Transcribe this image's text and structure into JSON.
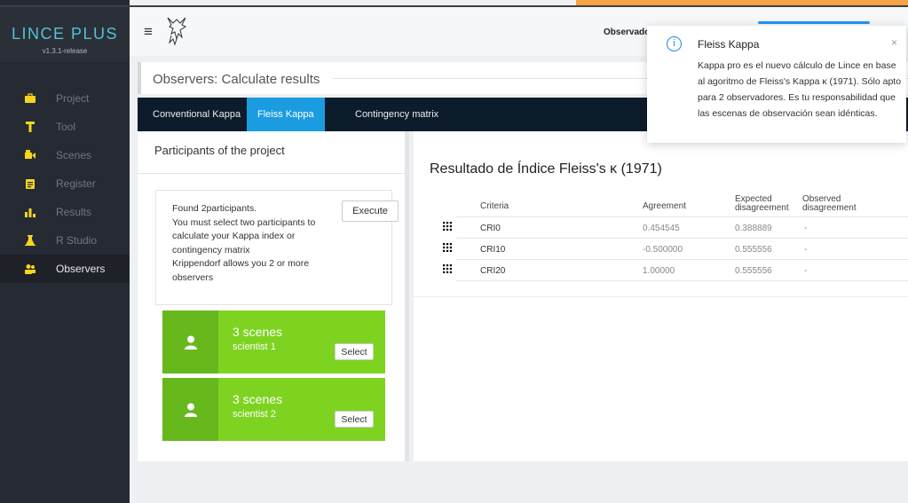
{
  "app": {
    "brand": "LINCE PLUS",
    "version": "v1.3.1-release"
  },
  "sidebar": {
    "items": [
      {
        "label": "Project",
        "icon": "briefcase-icon"
      },
      {
        "label": "Tool",
        "icon": "tool-icon"
      },
      {
        "label": "Scenes",
        "icon": "video-camera-icon"
      },
      {
        "label": "Register",
        "icon": "clipboard-icon"
      },
      {
        "label": "Results",
        "icon": "bar-chart-icon"
      },
      {
        "label": "R Studio",
        "icon": "flask-icon"
      },
      {
        "label": "Observers",
        "icon": "users-icon"
      }
    ],
    "active": "Observers"
  },
  "header": {
    "menu_icon": "hamburger-icon",
    "observer_label": "Observado"
  },
  "page": {
    "title": "Observers: Calculate results"
  },
  "tabs": [
    "Conventional Kappa",
    "Fleiss Kappa",
    "Contingency matrix"
  ],
  "active_tab": "Fleiss Kappa",
  "participants": {
    "header": "Participants of the project",
    "info_lines": [
      "Found 2participants.",
      "You must select two participants to calculate your Kappa index or contingency matrix",
      "Krippendorf allows you 2 or more observers"
    ],
    "execute_label": "Execute",
    "cards": [
      {
        "scenes": "3 scenes",
        "name": "scientist 1",
        "select_label": "Select"
      },
      {
        "scenes": "3 scenes",
        "name": "scientist 2",
        "select_label": "Select"
      }
    ]
  },
  "results": {
    "title": "Resultado de Índice Fleiss's κ (1971)",
    "columns": {
      "criteria": "Criteria",
      "agreement": "Agreement",
      "expected_1": "Expected",
      "expected_2": "disagreement",
      "observed_1": "Observed",
      "observed_2": "disagreement"
    },
    "rows": [
      {
        "criteria": "CRI0",
        "agreement": "0.454545",
        "expected": "0.388889",
        "observed": "-"
      },
      {
        "criteria": "CRI10",
        "agreement": "-0.500000",
        "expected": "0.555556",
        "observed": "-"
      },
      {
        "criteria": "CRI20",
        "agreement": "1.00000",
        "expected": "0.555556",
        "observed": "-"
      }
    ]
  },
  "toast": {
    "icon": "info-icon",
    "title": "Fleiss Kappa",
    "close": "×",
    "body": "Kappa pro es el nuevo cálculo de Lince en base al agoritmo de Fleiss's Kappa κ (1971). Sólo apto para 2 observadores. Es tu responsabilidad que las escenas de observación sean idénticas."
  }
}
